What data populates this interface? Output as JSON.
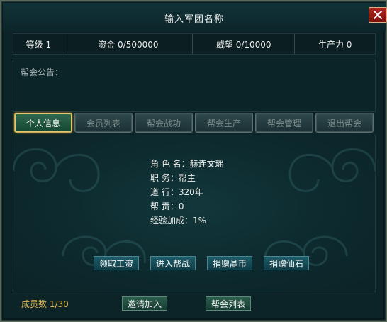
{
  "window": {
    "title": "输入军团名称",
    "close_icon": "close-icon",
    "accent": "#b0241f"
  },
  "stats": [
    {
      "label": "等级 1"
    },
    {
      "label": "资金 0/500000"
    },
    {
      "label": "威望 0/10000"
    },
    {
      "label": "生产力 0"
    }
  ],
  "notice": {
    "label": "帮会公告："
  },
  "tabs": [
    {
      "label": "个人信息",
      "active": true
    },
    {
      "label": "会员列表",
      "active": false
    },
    {
      "label": "帮会战功",
      "active": false
    },
    {
      "label": "帮会生产",
      "active": false
    },
    {
      "label": "帮会管理",
      "active": false
    },
    {
      "label": "退出帮会",
      "active": false
    }
  ],
  "info": {
    "role_label": "角 色 名：",
    "role_value": "赫连文瑶",
    "position_label": "职    务：",
    "position_value": "帮主",
    "daoxing_label": "道    行：",
    "daoxing_value": "320年",
    "contribution_label": "帮    贡：",
    "contribution_value": "0",
    "exp_label": "经验加成：",
    "exp_value": "1%"
  },
  "actions": [
    {
      "label": "领取工资"
    },
    {
      "label": "进入帮战"
    },
    {
      "label": "捐赠晶币"
    },
    {
      "label": "捐赠仙石"
    }
  ],
  "footer": {
    "member_count": "成员数 1/30",
    "invite_label": "邀请加入",
    "list_label": "帮会列表"
  }
}
